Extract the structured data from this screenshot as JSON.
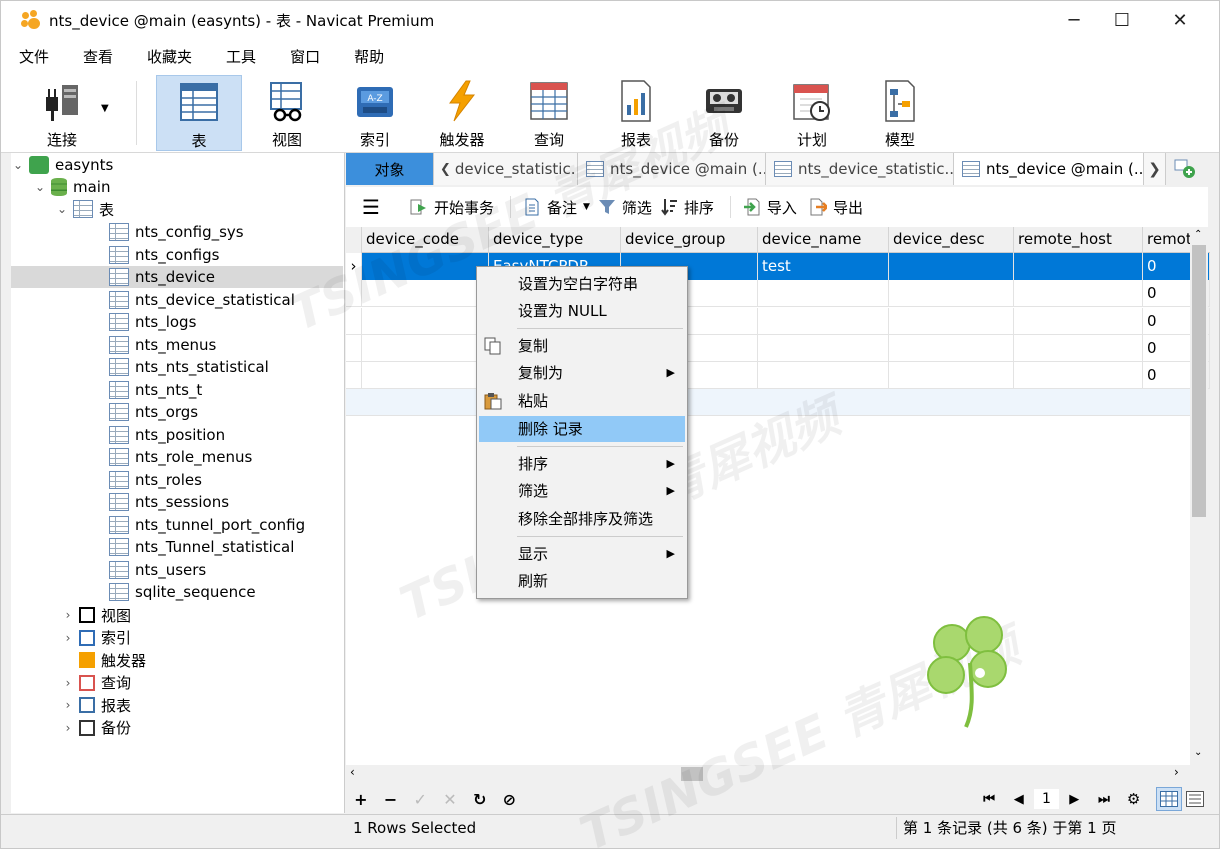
{
  "window": {
    "title": "nts_device @main (easynts) - 表 - Navicat Premium"
  },
  "menu": [
    "文件",
    "查看",
    "收藏夹",
    "工具",
    "窗口",
    "帮助"
  ],
  "toolbar": {
    "connect": "连接",
    "table": "表",
    "view": "视图",
    "index": "索引",
    "trigger": "触发器",
    "query": "查询",
    "report": "报表",
    "backup": "备份",
    "schedule": "计划",
    "model": "模型"
  },
  "tree": {
    "connection": "easynts",
    "database": "main",
    "tables_group": "表",
    "tables": [
      "nts_config_sys",
      "nts_configs",
      "nts_device",
      "nts_device_statistical",
      "nts_logs",
      "nts_menus",
      "nts_nts_statistical",
      "nts_nts_t",
      "nts_orgs",
      "nts_position",
      "nts_role_menus",
      "nts_roles",
      "nts_sessions",
      "nts_tunnel_port_config",
      "nts_Tunnel_statistical",
      "nts_users",
      "sqlite_sequence"
    ],
    "selected_table": "nts_device",
    "other_groups": [
      "视图",
      "索引",
      "触发器",
      "查询",
      "报表",
      "备份"
    ]
  },
  "tabs": {
    "objects": "对象",
    "items": [
      "device_statistic...",
      "nts_device @main (...",
      "nts_device_statistic...",
      "nts_device @main (..."
    ]
  },
  "subtoolbar": {
    "begin_tx": "开始事务",
    "note": "备注",
    "filter": "筛选",
    "sort": "排序",
    "import": "导入",
    "export": "导出"
  },
  "grid": {
    "columns": [
      "device_code",
      "device_type",
      "device_group",
      "device_name",
      "device_desc",
      "remote_host",
      "remot"
    ],
    "rows": [
      {
        "device_code": "",
        "device_type": "EasyNTCPDP",
        "device_group": "",
        "device_name": "test",
        "device_desc": "",
        "remote_host": "",
        "remot": "0"
      },
      {
        "device_code": "",
        "device_type": "",
        "device_group": "",
        "device_name": "",
        "device_desc": "",
        "remote_host": "",
        "remot": "0"
      },
      {
        "device_code": "",
        "device_type": "",
        "device_group": "",
        "device_name": "",
        "device_desc": "",
        "remote_host": "",
        "remot": "0"
      },
      {
        "device_code": "",
        "device_type": "",
        "device_group": "",
        "device_name": "",
        "device_desc": "",
        "remote_host": "",
        "remot": "0"
      },
      {
        "device_code": "",
        "device_type": "",
        "device_group": "",
        "device_name": "",
        "device_desc": "",
        "remote_host": "",
        "remot": "0"
      }
    ]
  },
  "context_menu": {
    "set_empty": "设置为空白字符串",
    "set_null": "设置为 NULL",
    "copy": "复制",
    "copy_as": "复制为",
    "paste": "粘贴",
    "delete": "删除 记录",
    "sort": "排序",
    "filter": "筛选",
    "remove_all": "移除全部排序及筛选",
    "display": "显示",
    "refresh": "刷新"
  },
  "pager": {
    "page": "1"
  },
  "status": {
    "selected": "1 Rows Selected",
    "records": "第 1 条记录 (共 6 条) 于第 1 页"
  },
  "watermark": {
    "text": "TSINGSEE 青犀视频"
  }
}
